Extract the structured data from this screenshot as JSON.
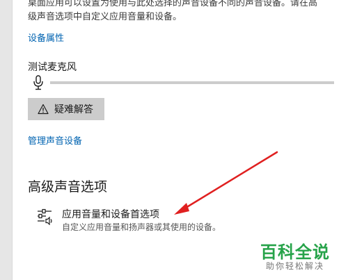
{
  "description": {
    "line1": "桌面应用可以设置为使用与此处选择的声音设备不同的声音设备。请在高",
    "line2": "级声音选项中自定义应用音量和设备。"
  },
  "device_properties_link": "设备属性",
  "mic_test": {
    "label": "测试麦克风",
    "icon": "microphone-icon",
    "level": 0
  },
  "troubleshoot": {
    "label": "疑难解答",
    "icon": "warning-icon"
  },
  "manage_devices_link": "管理声音设备",
  "advanced": {
    "title": "高级声音选项",
    "app_volume": {
      "title": "应用音量和设备首选项",
      "subtitle": "自定义应用音量和扬声器或其使用的设备。",
      "icon": "sliders-speaker-icon"
    }
  },
  "watermark": {
    "title": "百科全说",
    "subtitle": "助你轻松解决"
  },
  "colors": {
    "link": "#0063b1",
    "button_bg": "#cccccc",
    "annotation_arrow": "#e02020",
    "watermark": "#27a34a"
  }
}
